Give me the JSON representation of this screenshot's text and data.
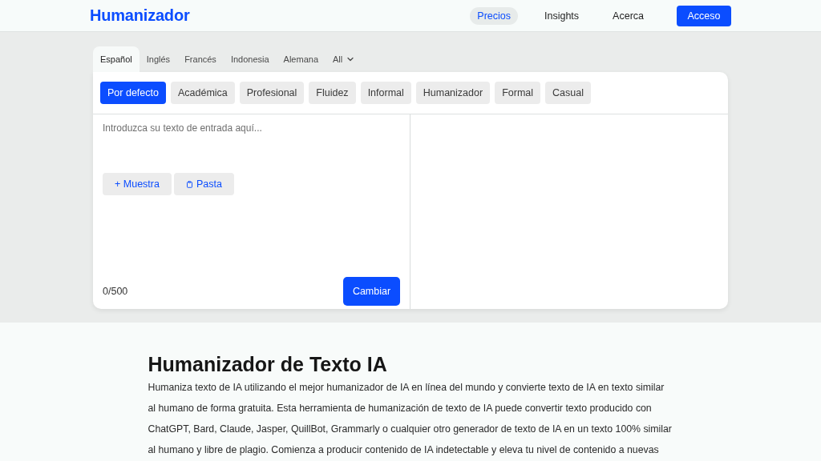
{
  "header": {
    "logo": "Humanizador",
    "nav": [
      {
        "label": "Precios",
        "selected": true
      },
      {
        "label": "Insights",
        "selected": false
      },
      {
        "label": "Acerca",
        "selected": false
      }
    ],
    "cta": "Acceso"
  },
  "language_tabs": [
    {
      "label": "Español",
      "selected": true,
      "kind": "tab"
    },
    {
      "label": "Inglés",
      "selected": false,
      "kind": "tab"
    },
    {
      "label": "Francés",
      "selected": false,
      "kind": "tab"
    },
    {
      "label": "Indonesia",
      "selected": false,
      "kind": "tab"
    },
    {
      "label": "Alemana",
      "selected": false,
      "kind": "tab"
    },
    {
      "label": "All",
      "selected": false,
      "kind": "dropdown"
    }
  ],
  "modes": [
    {
      "label": "Por defecto",
      "selected": true
    },
    {
      "label": "Académica",
      "selected": false
    },
    {
      "label": "Profesional",
      "selected": false
    },
    {
      "label": "Fluidez",
      "selected": false
    },
    {
      "label": "Informal",
      "selected": false
    },
    {
      "label": "Humanizador",
      "selected": false
    },
    {
      "label": "Formal",
      "selected": false
    },
    {
      "label": "Casual",
      "selected": false
    }
  ],
  "editor": {
    "input": {
      "placeholder": "Introduzca su texto de entrada aquí..."
    },
    "actions": [
      {
        "label": "+ Muestra",
        "kind": "plain"
      },
      {
        "label": "Pasta",
        "kind": "paste"
      }
    ],
    "counter": "0/500",
    "submit": "Cambiar"
  },
  "article": {
    "title": "Humanizador de Texto IA",
    "body": "Humaniza texto de IA utilizando el mejor humanizador de IA en línea del mundo y convierte texto de IA en texto similar al humano de forma gratuita. Esta herramienta de humanización de texto de IA puede convertir texto producido con ChatGPT, Bard, Claude, Jasper, QuillBot, Grammarly o cualquier otro generador de texto de IA en un texto 100% similar al humano y libre de plagio. Comienza a producir contenido de IA indetectable y eleva tu nivel de contenido a nuevas"
  }
}
